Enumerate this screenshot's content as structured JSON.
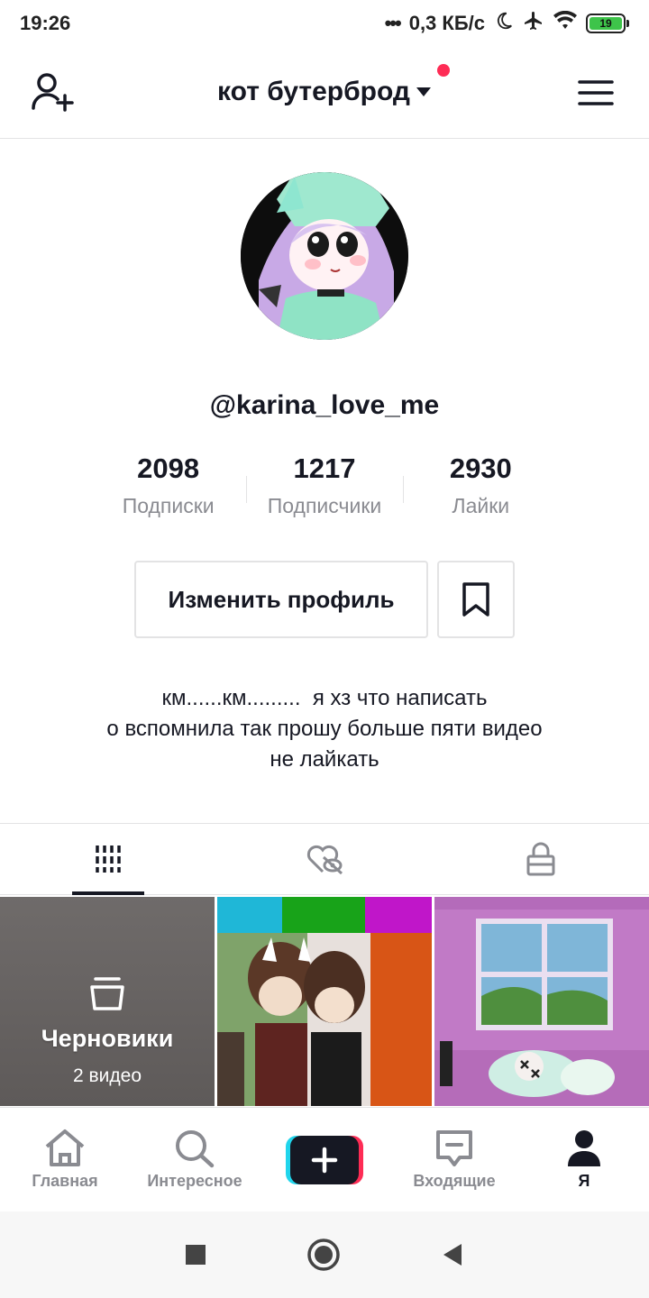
{
  "status_bar": {
    "time": "19:26",
    "network_speed": "0,3 КБ/с",
    "battery_level": "19",
    "icons": [
      "dots-icon",
      "moon-icon",
      "airplane-icon",
      "wifi-icon",
      "battery-icon"
    ]
  },
  "top_nav": {
    "title": "кот бутерброд",
    "left_icon": "add-user-icon",
    "right_icon": "menu-icon",
    "notification_color": "#fe2c55"
  },
  "profile": {
    "username": "@karina_love_me",
    "stats": [
      {
        "value": "2098",
        "label": "Подписки"
      },
      {
        "value": "1217",
        "label": "Подписчики"
      },
      {
        "value": "2930",
        "label": "Лайки"
      }
    ],
    "edit_button_label": "Изменить профиль",
    "bio_lines": [
      "км......км.........  я хз что написать",
      "о вспомнила так прошу больше пяти видео",
      "не лайкать"
    ]
  },
  "tabs": [
    {
      "icon": "grid-icon",
      "active": true
    },
    {
      "icon": "liked-hidden-icon",
      "active": false
    },
    {
      "icon": "lock-icon",
      "active": false
    }
  ],
  "videos": {
    "drafts_label": "Черновики",
    "drafts_count": "2 видео"
  },
  "bottom_nav": [
    {
      "label": "Главная",
      "icon": "home-icon"
    },
    {
      "label": "Интересное",
      "icon": "search-icon"
    },
    {
      "label": "",
      "icon": "plus-icon"
    },
    {
      "label": "Входящие",
      "icon": "inbox-icon"
    },
    {
      "label": "Я",
      "icon": "profile-icon",
      "active": true
    }
  ],
  "colors": {
    "accent_red": "#fe2c55",
    "accent_cyan": "#20d5ec",
    "text_primary": "#161823",
    "text_secondary": "#8a8b91"
  }
}
